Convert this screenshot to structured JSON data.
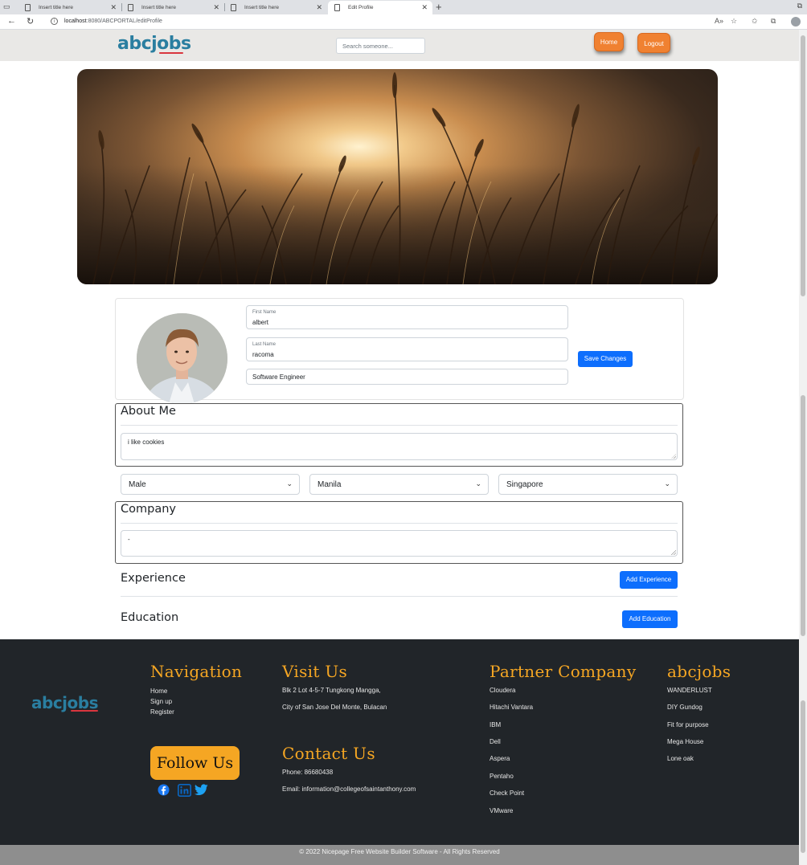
{
  "browser": {
    "tabs": [
      {
        "title": "Insert title here"
      },
      {
        "title": "Insert title here"
      },
      {
        "title": "Insert title here"
      },
      {
        "title": "Edit Profile"
      }
    ],
    "url_host": "localhost",
    "url_path": ":8080/ABCPORTAL/editProfile",
    "new_tab_label": "+"
  },
  "header": {
    "logo_text": "abcjobs",
    "search_placeholder": "Search someone...",
    "home_label": "Home",
    "logout_label": "Logout"
  },
  "profile": {
    "first_name_label": "First Name",
    "first_name": "albert",
    "last_name_label": "Last Name",
    "last_name": "racoma",
    "title": "Software Engineer",
    "save_label": "Save Changes"
  },
  "about": {
    "heading": "About Me",
    "text": "i like cookies"
  },
  "selects": {
    "gender": "Male",
    "city": "Manila",
    "country": "Singapore"
  },
  "company": {
    "heading": "Company",
    "text": "-"
  },
  "experience": {
    "heading": "Experience",
    "add_label": "Add Experience"
  },
  "education": {
    "heading": "Education",
    "add_label": "Add Education"
  },
  "footer": {
    "logo_text": "abcjobs",
    "navigation": {
      "heading": "Navigation",
      "links": [
        "Home",
        "Sign up",
        "Register"
      ]
    },
    "follow_label": "Follow Us",
    "visit": {
      "heading": "Visit Us",
      "line1": "Blk 2 Lot 4-5-7 Tungkong Mangga,",
      "line2": "City of San Jose Del Monte, Bulacan"
    },
    "contact": {
      "heading": "Contact Us",
      "phone": "Phone: 86680438",
      "email": "Email: information@collegeofsaintanthony.com"
    },
    "partners": {
      "heading": "Partner Company",
      "items": [
        "Cloudera",
        "Hitachi Vantara",
        "IBM",
        "Dell",
        "Aspera",
        "Pentaho",
        "Check Point",
        "VMware"
      ]
    },
    "brand": {
      "heading": "abcjobs",
      "items": [
        "WANDERLUST",
        "DIY Gundog",
        "Fit for purpose",
        "Mega House",
        "Lone oak"
      ]
    },
    "copyright": "© 2022 Nicepage Free Website Builder Software - All Rights Reserved"
  },
  "colors": {
    "accent_orange": "#f08131",
    "primary_blue": "#0d6efd",
    "footer_bg": "#212529",
    "footer_heading": "#f5a623",
    "logo_blue": "#2a7ea0"
  },
  "icons": [
    "back-arrow-icon",
    "reload-icon",
    "info-icon",
    "read-aloud-icon",
    "favorite-add-icon",
    "favorites-icon",
    "collections-icon",
    "profile-icon",
    "chevron-down-icon",
    "facebook-icon",
    "linkedin-icon",
    "twitter-icon"
  ]
}
